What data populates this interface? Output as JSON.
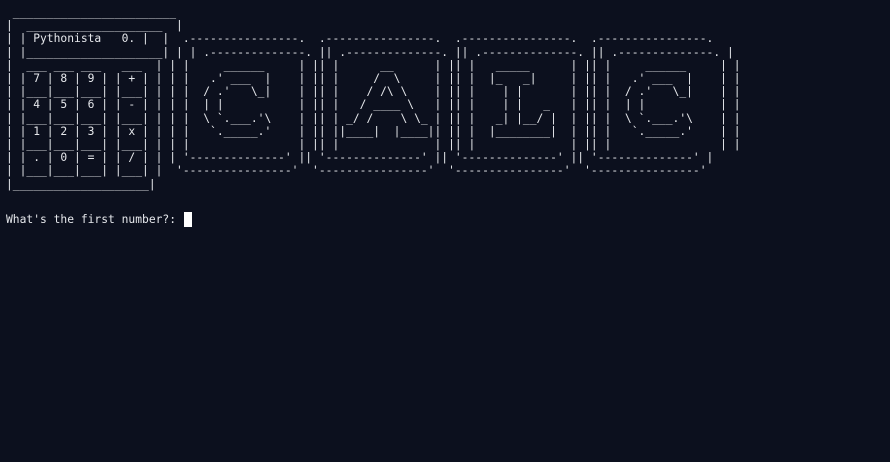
{
  "terminal": {
    "banner_lines": [
      " ________________________",
      "|  ____________________  |",
      "| | Pythonista   0. |  |  .----------------.  .----------------.  .----------------.  .----------------.",
      "| |____________________| | | .--------------. || .--------------. || .--------------. || .--------------. |",
      "|  ___ ___ ___   ___  | | |     ______     | || |      __      | || |   _____      | || |     ______     | |",
      "| | 7 | 8 | 9 | | + | | | |   .' ___  |    | || |     /  \\     | || |  |_   _|     | || |   .' ___  |    | |",
      "| |___|___|___| |___| | | |  / .'   \\_|    | || |    / /\\ \\    | || |    | |       | || |  / .'   \\_|    | |",
      "| | 4 | 5 | 6 | | - | | | |  | |           | || |   / ____ \\   | || |    | |   _   | || |  | |           | |",
      "| |___|___|___| |___| | | |  \\ `.___.'\\    | || | _/ /    \\ \\_ | || |   _| |__/ |  | || |  \\ `.___.'\\    | |",
      "| | 1 | 2 | 3 | | x | | | |   `._____.'    | || ||____|  |____|| || |  |________|  | || |   `._____.'    | |",
      "| |___|___|___| |___| | | |                | || |              | || |              | || |                | |",
      "| | . | 0 | = | | / | | | '--------------' || '--------------' || '--------------' || '--------------' |",
      "| |___|___|___| |___| |  '----------------'  '----------------'  '----------------'  '----------------'",
      "|____________________|"
    ],
    "prompt": "What's the first number?: "
  }
}
